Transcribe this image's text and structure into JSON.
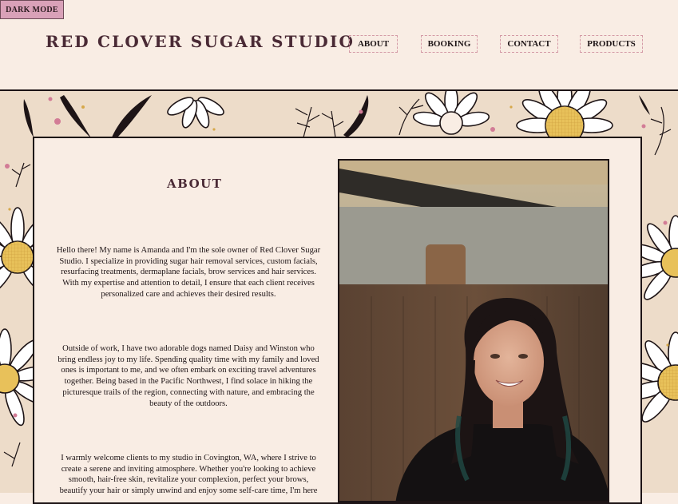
{
  "toggle": {
    "label": "DARK MODE"
  },
  "header": {
    "brand": "RED CLOVER SUGAR STUDIO",
    "nav": [
      {
        "label": "ABOUT"
      },
      {
        "label": "BOOKING"
      },
      {
        "label": "CONTACT"
      },
      {
        "label": "PRODUCTS"
      }
    ]
  },
  "about": {
    "title": "ABOUT",
    "paragraphs": [
      "Hello there! My name is Amanda and I'm the sole owner of Red Clover Sugar Studio. I specialize in providing sugar hair removal services, custom facials, resurfacing treatments, dermaplane facials, brow services and hair services. With my expertise and attention to detail, I ensure that each client receives personalized care and achieves their desired results.",
      "Outside of work, I have two adorable dogs named Daisy and Winston who bring endless joy to my life. Spending quality time with my family and loved ones is important to me, and we often embark on exciting travel adventures together. Being based in the Pacific Northwest, I find solace in hiking the picturesque trails of the region, connecting with nature, and embracing the beauty of the outdoors.",
      "I warmly welcome clients to my studio in Covington, WA, where I strive to create a serene and inviting atmosphere. Whether you're looking to achieve smooth, hair-free skin, revitalize your complexion, perfect your brows, beautify your hair or simply unwind and enjoy some self-care time, I'm here"
    ]
  },
  "colors": {
    "background": "#f9ede4",
    "accent": "#d9a1b8",
    "brand": "#4a2a35",
    "ink": "#1d1416",
    "daisy_center": "#e8c15a"
  }
}
